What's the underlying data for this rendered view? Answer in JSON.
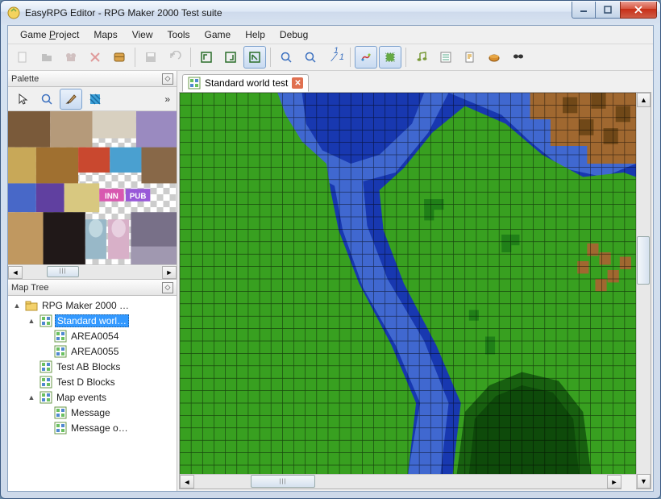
{
  "window": {
    "title": "EasyRPG Editor - RPG Maker 2000 Test suite"
  },
  "menu": {
    "items": [
      "Game Project",
      "Maps",
      "View",
      "Tools",
      "Game",
      "Help",
      "Debug"
    ],
    "underline": [
      5,
      null,
      null,
      null,
      null,
      null,
      null
    ]
  },
  "toolbar": {
    "groups": [
      [
        "new-icon",
        "open-icon",
        "char-icon",
        "delete-icon",
        "database-icon"
      ],
      [
        "save-icon",
        "undo-icon"
      ],
      [
        "layer1-icon",
        "layer2-icon",
        "layer3-icon"
      ],
      [
        "zoom-in-icon",
        "zoom-out-icon",
        "scale-11-icon"
      ],
      [
        "draw-tool-icon",
        "fill-tool-icon"
      ],
      [
        "music-icon",
        "list-icon",
        "script-icon",
        "pack-icon",
        "search-icon"
      ]
    ],
    "active_index": [
      2,
      2
    ],
    "active2_index": [
      4,
      0
    ],
    "active3_index": [
      4,
      1
    ],
    "scale_label": "1/1"
  },
  "palette": {
    "title": "Palette",
    "tools": [
      "arrow-icon",
      "magnify-icon",
      "brush-icon",
      "pattern-icon"
    ],
    "active_tool": 2
  },
  "maptree": {
    "title": "Map Tree",
    "root": "RPG Maker 2000 …",
    "items": [
      {
        "depth": 0,
        "expand": "▲",
        "icon": "folder",
        "label": "RPG Maker 2000 …"
      },
      {
        "depth": 1,
        "expand": "▲",
        "icon": "map",
        "label": "Standard worl…",
        "selected": true
      },
      {
        "depth": 2,
        "expand": "",
        "icon": "map",
        "label": "AREA0054"
      },
      {
        "depth": 2,
        "expand": "",
        "icon": "map",
        "label": "AREA0055"
      },
      {
        "depth": 1,
        "expand": "",
        "icon": "map",
        "label": "Test AB Blocks"
      },
      {
        "depth": 1,
        "expand": "",
        "icon": "map",
        "label": "Test D Blocks"
      },
      {
        "depth": 1,
        "expand": "▲",
        "icon": "map",
        "label": "Map events"
      },
      {
        "depth": 2,
        "expand": "",
        "icon": "map",
        "label": "Message"
      },
      {
        "depth": 2,
        "expand": "",
        "icon": "map",
        "label": "Message o…"
      }
    ]
  },
  "tabs": {
    "active": "Standard world test"
  },
  "map_colors": {
    "deep_water": "#1838b0",
    "shallow_water": "#4068d0",
    "grass": "#38a020",
    "dark_grass": "#208018",
    "forest": "#186010",
    "dirt": "#a06830",
    "dark_dirt": "#704818",
    "grid": "#000000"
  }
}
